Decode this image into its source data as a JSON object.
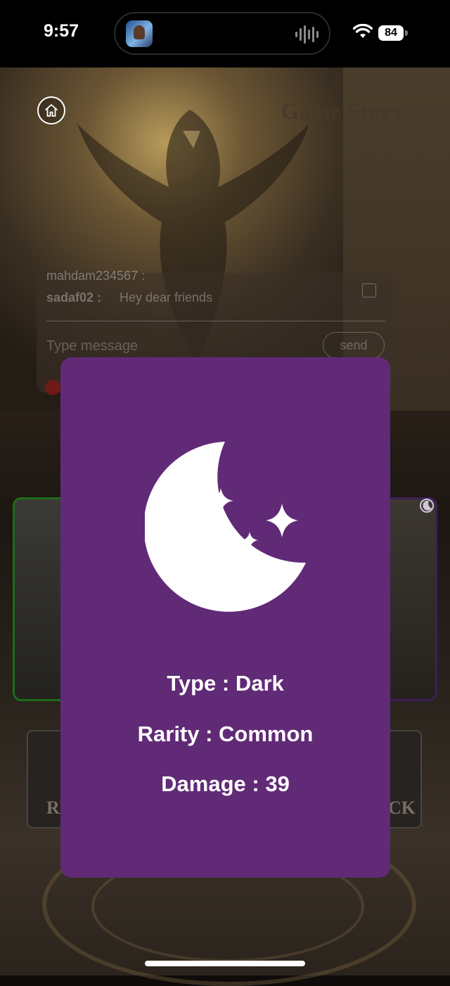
{
  "status_bar": {
    "time": "9:57",
    "battery": "84",
    "icons": [
      "app-icon",
      "audio-wave-icon",
      "wifi-icon",
      "battery-icon"
    ]
  },
  "background": {
    "title": "Game Story",
    "chat": {
      "previous_user_partial": "mahdam234567 :",
      "username": "sadaf02 :",
      "message": "Hey dear friends",
      "input_placeholder": "Type message",
      "send_label": "send"
    },
    "left_button_text": "RE",
    "right_button_text": "CK"
  },
  "card": {
    "background_color": "#612a76",
    "icon": "moon-stars-icon",
    "type_text": "Type : Dark",
    "rarity_text": "Rarity : Common",
    "damage_text": "Damage : 39"
  }
}
